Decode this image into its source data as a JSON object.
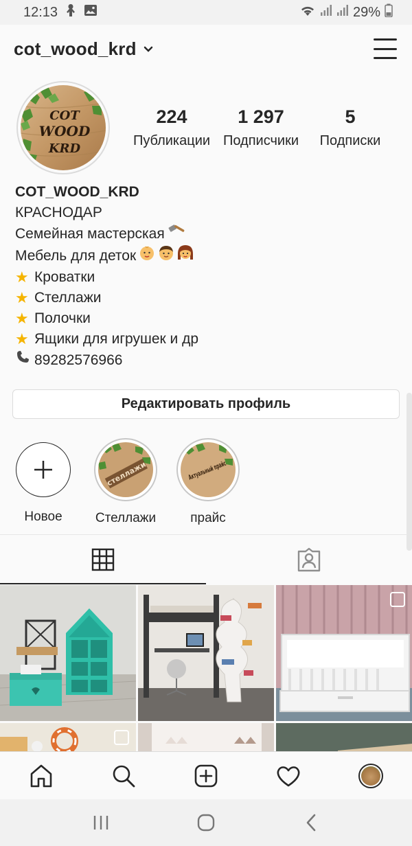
{
  "status_bar": {
    "time": "12:13",
    "battery": "29%"
  },
  "header": {
    "username": "cot_wood_krd"
  },
  "profile": {
    "avatar_logo": [
      "COT",
      "WOOD",
      "KRD"
    ],
    "stats": [
      {
        "value": "224",
        "label": "Публикации"
      },
      {
        "value": "1 297",
        "label": "Подписчики"
      },
      {
        "value": "5",
        "label": "Подписки"
      }
    ],
    "bio": {
      "name": "COT_WOOD_KRD",
      "city": "КРАСНОДАР",
      "line1": "Семейная мастерская",
      "line2": "Мебель для деток",
      "items": [
        "Кроватки",
        "Стеллажи",
        "Полочки",
        "Ящики для игрушек  и др"
      ],
      "phone": "89282576966"
    },
    "edit_button": "Редактировать профиль"
  },
  "highlights": [
    {
      "label": "Новое",
      "badge": ""
    },
    {
      "label": "Стеллажи",
      "badge": "стеллажи"
    },
    {
      "label": "прайс",
      "badge": "Актуальный прайс"
    }
  ],
  "colors": {
    "text": "#262626",
    "border": "#dbdbdb",
    "background": "#fafafa",
    "star": "#f5b400"
  },
  "icons": {
    "tabs": [
      "grid-icon",
      "tagged-icon"
    ],
    "bottom_nav": [
      "home-icon",
      "search-icon",
      "add-post-icon",
      "heart-icon",
      "profile-avatar"
    ]
  }
}
